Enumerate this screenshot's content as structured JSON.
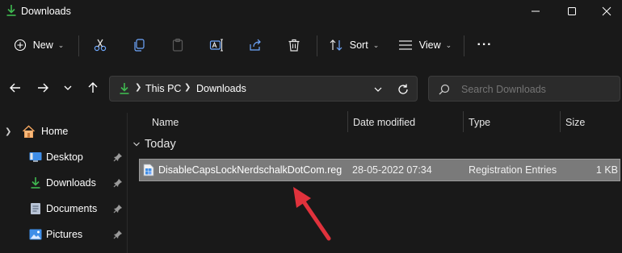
{
  "window": {
    "title": "Downloads"
  },
  "toolbar": {
    "new_label": "New",
    "sort_label": "Sort",
    "view_label": "View",
    "more_label": "···"
  },
  "address": {
    "segments": [
      "This PC",
      "Downloads"
    ]
  },
  "search": {
    "placeholder": "Search Downloads"
  },
  "sidebar": {
    "items": [
      {
        "label": "Home",
        "icon": "home-icon"
      },
      {
        "label": "Desktop",
        "icon": "desktop-icon"
      },
      {
        "label": "Downloads",
        "icon": "download-icon"
      },
      {
        "label": "Documents",
        "icon": "documents-icon"
      },
      {
        "label": "Pictures",
        "icon": "pictures-icon"
      }
    ]
  },
  "columns": {
    "name": "Name",
    "date": "Date modified",
    "type": "Type",
    "size": "Size"
  },
  "groups": [
    {
      "label": "Today",
      "files": [
        {
          "name": "DisableCapsLockNerdschalkDotCom.reg",
          "date": "28-05-2022 07:34",
          "type": "Registration Entries",
          "size": "1 KB"
        }
      ]
    }
  ],
  "colors": {
    "accent": "#3fb950",
    "background": "#191919",
    "selection": "#7a7a7a",
    "arrow": "#e0323c"
  }
}
